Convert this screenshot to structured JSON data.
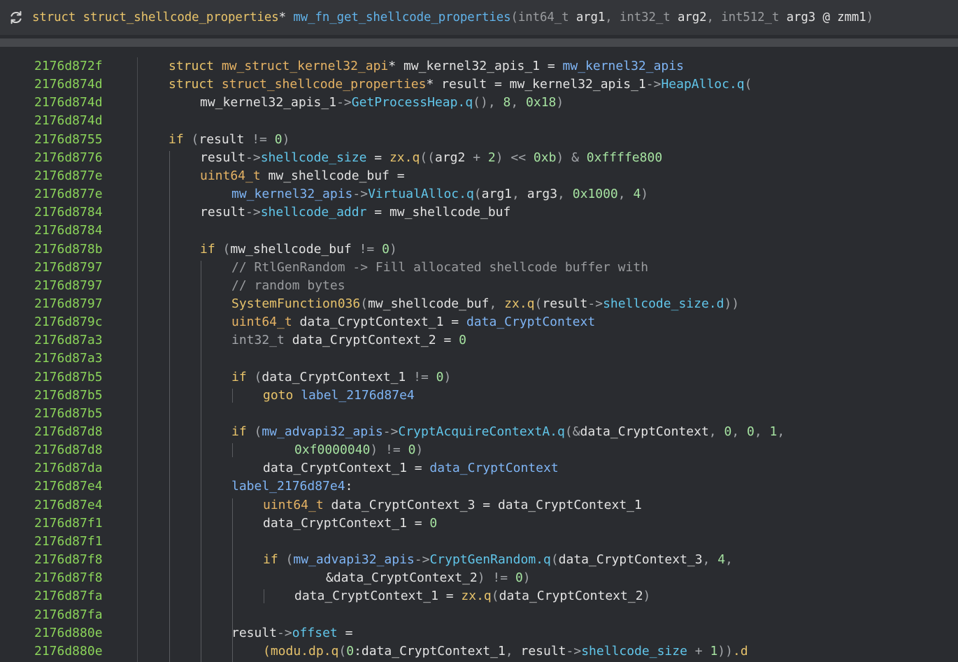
{
  "header": {
    "icon": "refresh-icon",
    "kw_struct": "struct",
    "ret_type": "struct_shellcode_properties",
    "star": "*",
    "func_name": "mw_fn_get_shellcode_properties",
    "open": "(",
    "p1_type": "int64_t",
    "p1_name": "arg1",
    "comma1": ",",
    "p2_type": "int32_t",
    "p2_name": "arg2",
    "comma2": ",",
    "p3_type": "int512_t",
    "p3_name": "arg3 @ zmm1",
    "close": ")"
  },
  "lines": [
    {
      "addr": "2176d872f",
      "indent": 0,
      "tokens": [
        [
          "kw",
          "struct "
        ],
        [
          "ty",
          "mw_struct_kernel32_api"
        ],
        [
          "plain",
          "* mw_kernel32_apis_1 = "
        ],
        [
          "gv",
          "mw_kernel32_apis"
        ]
      ]
    },
    {
      "addr": "2176d874d",
      "indent": 0,
      "tokens": [
        [
          "kw",
          "struct "
        ],
        [
          "ty",
          "struct_shellcode_properties"
        ],
        [
          "plain",
          "* result = mw_kernel32_apis_1"
        ],
        [
          "dim",
          "->"
        ],
        [
          "fld",
          "HeapAlloc.q"
        ],
        [
          "dim",
          "("
        ]
      ]
    },
    {
      "addr": "2176d874d",
      "indent": 1,
      "tokens": [
        [
          "plain",
          "mw_kernel32_apis_1"
        ],
        [
          "dim",
          "->"
        ],
        [
          "fld",
          "GetProcessHeap.q"
        ],
        [
          "dim",
          "(), "
        ],
        [
          "num",
          "8"
        ],
        [
          "dim",
          ", "
        ],
        [
          "num",
          "0x18"
        ],
        [
          "dim",
          ")"
        ]
      ]
    },
    {
      "addr": "2176d874d",
      "indent": 0,
      "tokens": []
    },
    {
      "addr": "2176d8755",
      "indent": 0,
      "tokens": [
        [
          "kw",
          "if "
        ],
        [
          "dim",
          "("
        ],
        [
          "plain",
          "result "
        ],
        [
          "dim",
          "!= "
        ],
        [
          "num",
          "0"
        ],
        [
          "dim",
          ")"
        ]
      ]
    },
    {
      "addr": "2176d8776",
      "indent": 1,
      "tokens": [
        [
          "plain",
          "result"
        ],
        [
          "dim",
          "->"
        ],
        [
          "fld",
          "shellcode_size"
        ],
        [
          "plain",
          " = "
        ],
        [
          "fn",
          "zx.q"
        ],
        [
          "dim",
          "(("
        ],
        [
          "plain",
          "arg2 "
        ],
        [
          "dim",
          "+ "
        ],
        [
          "num",
          "2"
        ],
        [
          "dim",
          ") << "
        ],
        [
          "num",
          "0xb"
        ],
        [
          "dim",
          ") & "
        ],
        [
          "num",
          "0xffffe800"
        ]
      ]
    },
    {
      "addr": "2176d877e",
      "indent": 1,
      "tokens": [
        [
          "ty",
          "uint64_t "
        ],
        [
          "plain",
          "mw_shellcode_buf ="
        ]
      ]
    },
    {
      "addr": "2176d877e",
      "indent": 2,
      "tokens": [
        [
          "gv",
          "mw_kernel32_apis"
        ],
        [
          "dim",
          "->"
        ],
        [
          "fld",
          "VirtualAlloc.q"
        ],
        [
          "dim",
          "("
        ],
        [
          "plain",
          "arg1"
        ],
        [
          "dim",
          ", "
        ],
        [
          "plain",
          "arg3"
        ],
        [
          "dim",
          ", "
        ],
        [
          "num",
          "0x1000"
        ],
        [
          "dim",
          ", "
        ],
        [
          "num",
          "4"
        ],
        [
          "dim",
          ")"
        ]
      ]
    },
    {
      "addr": "2176d8784",
      "indent": 1,
      "tokens": [
        [
          "plain",
          "result"
        ],
        [
          "dim",
          "->"
        ],
        [
          "fld",
          "shellcode_addr"
        ],
        [
          "plain",
          " = mw_shellcode_buf"
        ]
      ]
    },
    {
      "addr": "2176d8784",
      "indent": 0,
      "tokens": []
    },
    {
      "addr": "2176d878b",
      "indent": 1,
      "tokens": [
        [
          "kw",
          "if "
        ],
        [
          "dim",
          "("
        ],
        [
          "plain",
          "mw_shellcode_buf "
        ],
        [
          "dim",
          "!= "
        ],
        [
          "num",
          "0"
        ],
        [
          "dim",
          ")"
        ]
      ]
    },
    {
      "addr": "2176d8797",
      "indent": 2,
      "tokens": [
        [
          "cm",
          "// RtlGenRandom -> Fill allocated shellcode buffer with"
        ]
      ]
    },
    {
      "addr": "2176d8797",
      "indent": 2,
      "tokens": [
        [
          "cm",
          "// random bytes"
        ]
      ]
    },
    {
      "addr": "2176d8797",
      "indent": 2,
      "tokens": [
        [
          "fn",
          "SystemFunction036"
        ],
        [
          "dim",
          "("
        ],
        [
          "plain",
          "mw_shellcode_buf"
        ],
        [
          "dim",
          ", "
        ],
        [
          "fn",
          "zx.q"
        ],
        [
          "dim",
          "("
        ],
        [
          "plain",
          "result"
        ],
        [
          "dim",
          "->"
        ],
        [
          "fld",
          "shellcode_size.d"
        ],
        [
          "dim",
          "))"
        ]
      ]
    },
    {
      "addr": "2176d879c",
      "indent": 2,
      "tokens": [
        [
          "ty",
          "uint64_t "
        ],
        [
          "plain",
          "data_CryptContext_1 = "
        ],
        [
          "gv",
          "data_CryptContext"
        ]
      ]
    },
    {
      "addr": "2176d87a3",
      "indent": 2,
      "tokens": [
        [
          "dim",
          "int32_t "
        ],
        [
          "plain",
          "data_CryptContext_2 = "
        ],
        [
          "num",
          "0"
        ]
      ]
    },
    {
      "addr": "2176d87a3",
      "indent": 0,
      "tokens": []
    },
    {
      "addr": "2176d87b5",
      "indent": 2,
      "tokens": [
        [
          "kw",
          "if "
        ],
        [
          "dim",
          "("
        ],
        [
          "plain",
          "data_CryptContext_1 "
        ],
        [
          "dim",
          "!= "
        ],
        [
          "num",
          "0"
        ],
        [
          "dim",
          ")"
        ]
      ]
    },
    {
      "addr": "2176d87b5",
      "indent": 3,
      "tokens": [
        [
          "kw",
          "goto "
        ],
        [
          "gv",
          "label_2176d87e4"
        ]
      ]
    },
    {
      "addr": "2176d87b5",
      "indent": 0,
      "tokens": []
    },
    {
      "addr": "2176d87d8",
      "indent": 2,
      "tokens": [
        [
          "kw",
          "if "
        ],
        [
          "dim",
          "("
        ],
        [
          "gv",
          "mw_advapi32_apis"
        ],
        [
          "dim",
          "->"
        ],
        [
          "fld",
          "CryptAcquireContextA.q"
        ],
        [
          "dim",
          "(&"
        ],
        [
          "plain",
          "data_CryptContext"
        ],
        [
          "dim",
          ", "
        ],
        [
          "num",
          "0"
        ],
        [
          "dim",
          ", "
        ],
        [
          "num",
          "0"
        ],
        [
          "dim",
          ", "
        ],
        [
          "num",
          "1"
        ],
        [
          "dim",
          ","
        ]
      ]
    },
    {
      "addr": "2176d87d8",
      "indent": 4,
      "tokens": [
        [
          "num",
          "0xf0000040"
        ],
        [
          "dim",
          ") != "
        ],
        [
          "num",
          "0"
        ],
        [
          "dim",
          ")"
        ]
      ]
    },
    {
      "addr": "2176d87da",
      "indent": 3,
      "tokens": [
        [
          "plain",
          "data_CryptContext_1 = "
        ],
        [
          "gv",
          "data_CryptContext"
        ]
      ]
    },
    {
      "addr": "2176d87e4",
      "indent": 2,
      "tokens": [
        [
          "gv",
          "label_2176d87e4"
        ],
        [
          "plain",
          ":"
        ]
      ]
    },
    {
      "addr": "2176d87e4",
      "indent": 3,
      "tokens": [
        [
          "ty",
          "uint64_t "
        ],
        [
          "plain",
          "data_CryptContext_3 = data_CryptContext_1"
        ]
      ]
    },
    {
      "addr": "2176d87f1",
      "indent": 3,
      "tokens": [
        [
          "plain",
          "data_CryptContext_1 = "
        ],
        [
          "num",
          "0"
        ]
      ]
    },
    {
      "addr": "2176d87f1",
      "indent": 0,
      "tokens": []
    },
    {
      "addr": "2176d87f8",
      "indent": 3,
      "tokens": [
        [
          "kw",
          "if "
        ],
        [
          "dim",
          "("
        ],
        [
          "gv",
          "mw_advapi32_apis"
        ],
        [
          "dim",
          "->"
        ],
        [
          "fld",
          "CryptGenRandom.q"
        ],
        [
          "dim",
          "("
        ],
        [
          "plain",
          "data_CryptContext_3"
        ],
        [
          "dim",
          ", "
        ],
        [
          "num",
          "4"
        ],
        [
          "dim",
          ","
        ]
      ]
    },
    {
      "addr": "2176d87f8",
      "indent": 5,
      "tokens": [
        [
          "plain",
          "&data_CryptContext_2"
        ],
        [
          "dim",
          ") != "
        ],
        [
          "num",
          "0"
        ],
        [
          "dim",
          ")"
        ]
      ]
    },
    {
      "addr": "2176d87fa",
      "indent": 4,
      "tokens": [
        [
          "plain",
          "data_CryptContext_1 = "
        ],
        [
          "fn",
          "zx.q"
        ],
        [
          "dim",
          "("
        ],
        [
          "plain",
          "data_CryptContext_2"
        ],
        [
          "dim",
          ")"
        ]
      ]
    },
    {
      "addr": "2176d87fa",
      "indent": 0,
      "tokens": []
    },
    {
      "addr": "2176d880e",
      "indent": 2,
      "tokens": [
        [
          "plain",
          "result"
        ],
        [
          "dim",
          "->"
        ],
        [
          "fld",
          "offset"
        ],
        [
          "plain",
          " ="
        ]
      ]
    },
    {
      "addr": "2176d880e",
      "indent": 3,
      "tokens": [
        [
          "fn",
          "(modu.dp.q"
        ],
        [
          "dim",
          "("
        ],
        [
          "num",
          "0"
        ],
        [
          "plain",
          ":data_CryptContext_1"
        ],
        [
          "dim",
          ", "
        ],
        [
          "plain",
          "result"
        ],
        [
          "dim",
          "->"
        ],
        [
          "fld",
          "shellcode_size"
        ],
        [
          "dim",
          " + "
        ],
        [
          "num",
          "1"
        ],
        [
          "dim",
          "))"
        ],
        [
          "fn",
          ".d"
        ]
      ]
    }
  ]
}
